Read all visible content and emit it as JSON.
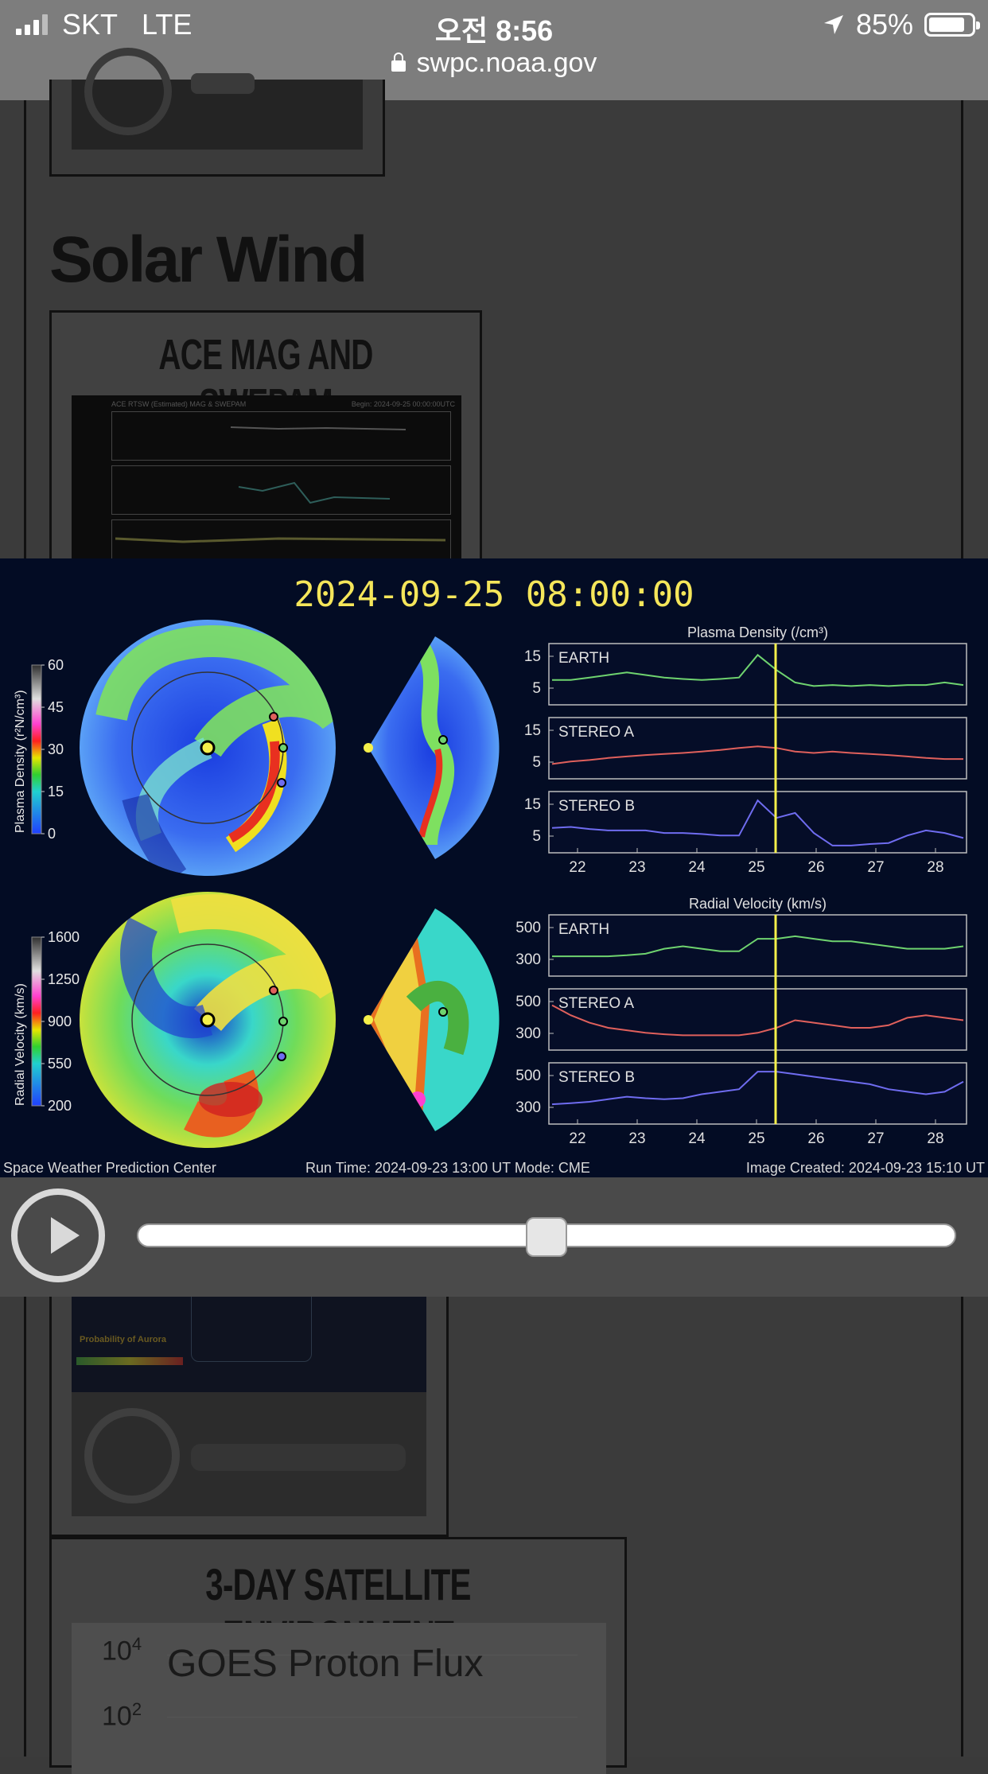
{
  "status": {
    "carrier": "SKT",
    "network": "LTE",
    "time": "오전 8:56",
    "battery": "85%",
    "battery_level": 0.85,
    "url": "swpc.noaa.gov"
  },
  "page": {
    "section_heading": "Solar Wind",
    "card1_title": "ACE MAG AND SWEPAM",
    "card3_title": "3-DAY SATELLITE ENVIRONMENT",
    "goes_label": "GOES Proton Flux",
    "goes_ticks": [
      "4",
      "2"
    ],
    "aurora_label": "Probability of Aurora",
    "ace_header_left": "ACE RTSW (Estimated) MAG & SWEPAM",
    "ace_header_right": "Begin: 2024-09-25 00:00:00UTC"
  },
  "animation": {
    "timestamp": "2024-09-25  08:00:00",
    "plasma_title": "Plasma Density (/cm³)",
    "velocity_title": "Radial Velocity (km/s)",
    "density_axis_label": "Plasma Density (r²N/cm³)",
    "velocity_axis_label": "Radial Velocity (km/s)",
    "density_ticks": [
      "60",
      "45",
      "30",
      "15",
      "0"
    ],
    "velocity_ticks": [
      "1600",
      "1250",
      "900",
      "550",
      "200"
    ],
    "panel_names": [
      "EARTH",
      "STEREO A",
      "STEREO B"
    ],
    "density_yticks": [
      "15",
      "5"
    ],
    "velocity_yticks": [
      "500",
      "300"
    ],
    "x_ticks": [
      "22",
      "23",
      "24",
      "25",
      "26",
      "27",
      "28"
    ],
    "footer_left": "Space Weather Prediction Center",
    "footer_mid": "Run Time: 2024-09-23 13:00 UT   Mode: CME",
    "footer_right": "Image Created: 2024-09-23 15:10 UT",
    "slider_position": 0.5,
    "colors": {
      "earth": "#6fd36f",
      "stereo_a": "#e0605c",
      "stereo_b": "#6f6cf0",
      "marker": "#f5f04a",
      "timestamp": "#f5e65a"
    }
  }
}
